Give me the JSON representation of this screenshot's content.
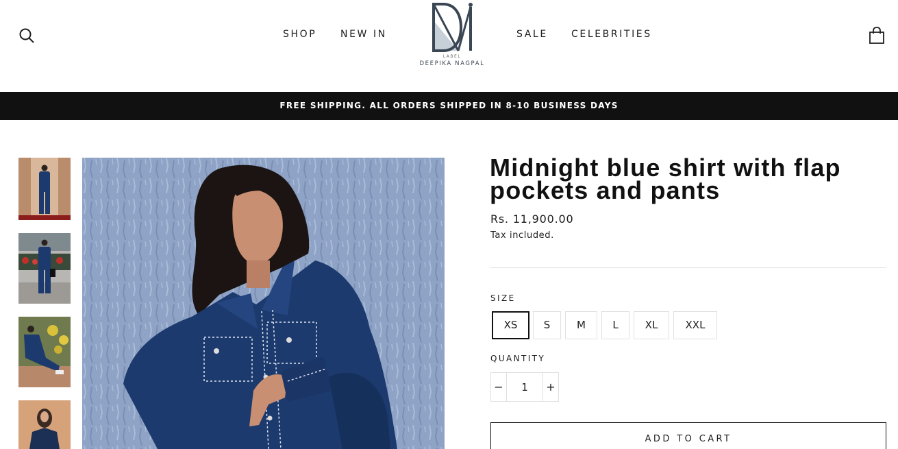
{
  "header": {
    "nav_left": [
      {
        "label": "SHOP"
      },
      {
        "label": "NEW IN"
      }
    ],
    "nav_right": [
      {
        "label": "SALE"
      },
      {
        "label": "CELEBRITIES"
      }
    ],
    "logo": {
      "small_text": "LABEL",
      "name": "DEEPIKA NAGPAL"
    },
    "icons": {
      "search": "search-icon",
      "cart": "cart-icon"
    }
  },
  "announcement": "FREE SHIPPING. ALL ORDERS SHIPPED IN 8-10 BUSINESS DAYS",
  "product": {
    "title": "Midnight blue shirt with flap pockets and pants",
    "price": "Rs. 11,900.00",
    "tax_note": "Tax included.",
    "size_label": "SIZE",
    "sizes": [
      "XS",
      "S",
      "M",
      "L",
      "XL",
      "XXL"
    ],
    "selected_size": "XS",
    "quantity_label": "QUANTITY",
    "quantity": "1",
    "qty_minus": "−",
    "qty_plus": "+",
    "add_to_cart": "ADD TO CART"
  },
  "colors": {
    "announcement_bg": "#111111",
    "garment_blue": "#1c3a6e",
    "wall_blue": "#8fa4c6"
  }
}
